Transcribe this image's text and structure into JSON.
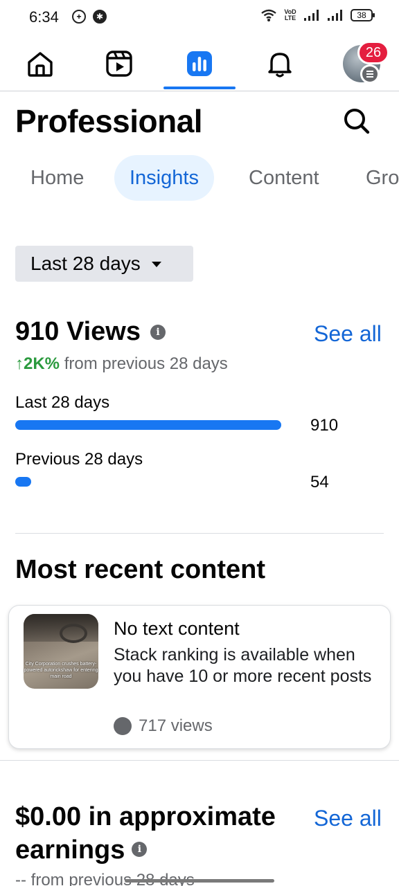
{
  "status_bar": {
    "time": "6:34",
    "network_label": "VoD LTE",
    "battery": "38"
  },
  "nav": {
    "items": [
      "home",
      "reels",
      "professional-dashboard",
      "notifications",
      "profile"
    ],
    "active": "professional-dashboard",
    "notification_count": "26",
    "accent": "#1877f2"
  },
  "header": {
    "title": "Professional"
  },
  "tabs": [
    {
      "label": "Home"
    },
    {
      "label": "Insights"
    },
    {
      "label": "Content"
    },
    {
      "label": "Gro"
    }
  ],
  "active_tab": "Insights",
  "date_filter": {
    "label": "Last 28 days"
  },
  "views": {
    "title": "910 Views",
    "see_all": "See all",
    "delta_value": "↑2K%",
    "delta_text": " from previous 28 days",
    "delta_color": "#2b9a3e",
    "rows": [
      {
        "label": "Last 28 days",
        "value": "910",
        "fraction": 1.0
      },
      {
        "label": "Previous 28 days",
        "value": "54",
        "fraction": 0.0593
      }
    ]
  },
  "recent": {
    "title": "Most recent content",
    "post": {
      "title": "No text content",
      "description": "Stack ranking is available when you have 10 or more recent posts",
      "views": "717 views",
      "thumb_caption": "City Corporation crushes battery-powered autorickshaw for entering main road"
    }
  },
  "earnings": {
    "title": "$0.00 in approximate earnings",
    "see_all": "See all",
    "delta_text": "-- from previous 28 days"
  }
}
